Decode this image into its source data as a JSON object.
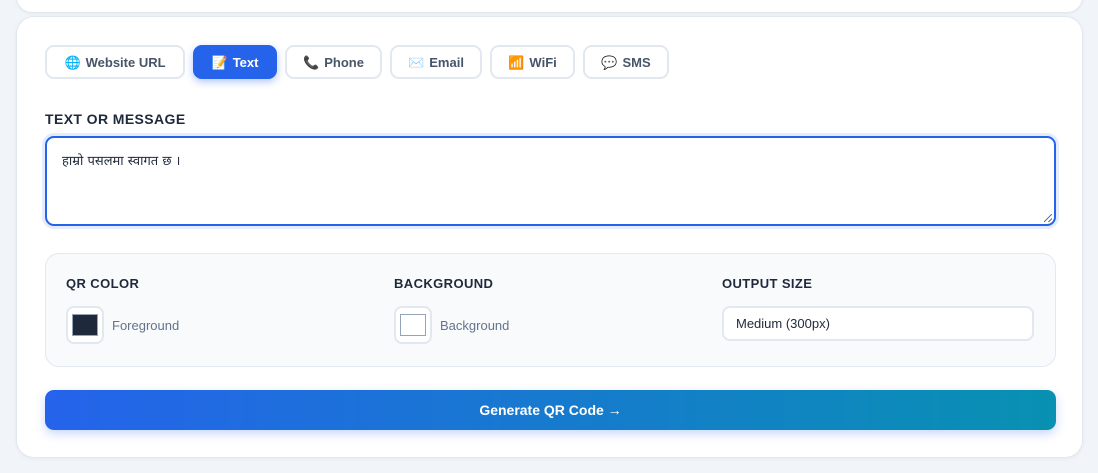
{
  "tabs": [
    {
      "icon": "🌐",
      "icon_name": "globe-icon",
      "label": "Website URL",
      "active": false
    },
    {
      "icon": "📝",
      "icon_name": "memo-icon",
      "label": "Text",
      "active": true
    },
    {
      "icon": "📞",
      "icon_name": "phone-icon",
      "label": "Phone",
      "active": false
    },
    {
      "icon": "✉️",
      "icon_name": "envelope-icon",
      "label": "Email",
      "active": false
    },
    {
      "icon": "📶",
      "icon_name": "signal-icon",
      "label": "WiFi",
      "active": false
    },
    {
      "icon": "💬",
      "icon_name": "speech-bubble-icon",
      "label": "SMS",
      "active": false
    }
  ],
  "text_field": {
    "label": "TEXT OR MESSAGE",
    "value": "हाम्रो पसलमा स्वागत छ ।"
  },
  "options": {
    "qr_color": {
      "label": "QR COLOR",
      "text": "Foreground",
      "color": "#1e293b"
    },
    "background": {
      "label": "BACKGROUND",
      "text": "Background",
      "color": "#ffffff"
    },
    "output_size": {
      "label": "OUTPUT SIZE",
      "selected": "Medium (300px)"
    }
  },
  "generate_button": {
    "label": "Generate QR Code →"
  },
  "colors": {
    "accent": "#2563eb",
    "gradient_end": "#0891b2"
  }
}
